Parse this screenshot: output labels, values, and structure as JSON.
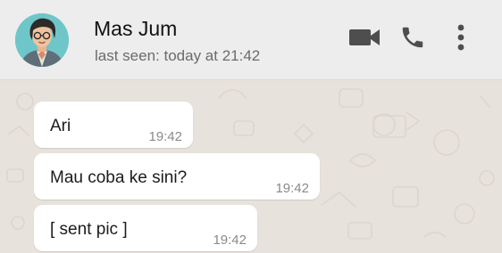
{
  "header": {
    "contact_name": "Mas Jum",
    "last_seen": "last seen: today at 21:42",
    "avatar_icon": "cartoon-man-avatar",
    "actions": [
      {
        "name": "video-call",
        "icon": "video-camera-icon"
      },
      {
        "name": "voice-call",
        "icon": "phone-icon"
      },
      {
        "name": "more-options",
        "icon": "more-vertical-icon"
      }
    ]
  },
  "messages": [
    {
      "text": "Ari",
      "time": "19:42"
    },
    {
      "text": "Mau coba ke sini?",
      "time": "19:42"
    },
    {
      "text": "[ sent pic ]",
      "time": "19:42"
    }
  ],
  "colors": {
    "header_bg": "#ededed",
    "chat_bg": "#e7e2dc",
    "bubble_bg": "#ffffff",
    "icon_color": "#4e4e4e",
    "avatar_bg": "#6fc6c9"
  }
}
